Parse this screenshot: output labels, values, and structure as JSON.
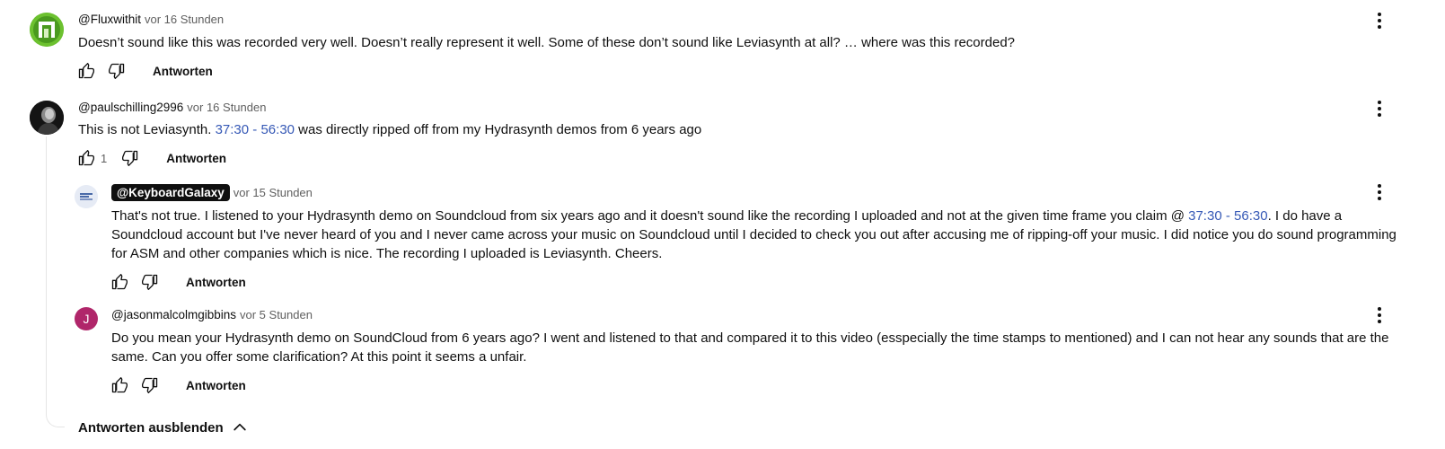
{
  "comments": [
    {
      "author": "@Fluxwithit",
      "time": "vor 16 Stunden",
      "text": "Doesn’t sound like this was recorded very well. Doesn’t really represent it well.  Some of these don’t sound like Leviasynth at all? … where was this recorded?",
      "reply_label": "Antworten",
      "avatar_colors": {
        "bg": "#6cbf2e",
        "fg": "#ffffff"
      }
    },
    {
      "author": "@paulschilling2996",
      "time": "vor 16 Stunden",
      "text_before": "This is not Leviasynth. ",
      "ts1": "37:30",
      "dash": " - ",
      "ts2": "56:30",
      "text_after": " was directly ripped off from my Hydrasynth demos from 6 years ago",
      "likes": "1",
      "reply_label": "Antworten"
    }
  ],
  "replies": [
    {
      "author": "@KeyboardGalaxy",
      "time": "vor 15 Stunden",
      "text_before": "That's not true. I listened to your Hydrasynth demo on Soundcloud from six years ago and it doesn't sound like the recording I uploaded and not at the given time frame you claim @ ",
      "ts1": "37:30",
      "dash": " - ",
      "ts2": "56:30",
      "text_after": ". I do have a Soundcloud account but I've never heard of you and I never came across your music on Soundcloud until I decided to check you out after accusing me of ripping-off your music. I did notice you do sound programming for ASM and other companies which is nice. The recording I uploaded is Leviasynth. Cheers.",
      "reply_label": "Antworten"
    },
    {
      "author": "@jasonmalcolmgibbins",
      "avatar_letter": "J",
      "avatar_color": "#b0266a",
      "time": "vor 5 Stunden",
      "text": "Do you mean your Hydrasynth demo on SoundCloud from 6 years ago? I went and listened to that and compared it to this video (esspecially the time stamps to mentioned) and I can not hear any sounds that are the same. Can you offer some clarification? At this point it seems a unfair.",
      "reply_label": "Antworten"
    }
  ],
  "hide_replies_label": "Antworten ausblenden",
  "colors": {
    "timestamp_link": "#3659b6",
    "owner_badge": "#0f0f0f",
    "meta_gray": "#606060"
  },
  "icons": [
    "thumb-up-icon",
    "thumb-down-icon",
    "more-vert-icon",
    "chevron-up-icon"
  ]
}
